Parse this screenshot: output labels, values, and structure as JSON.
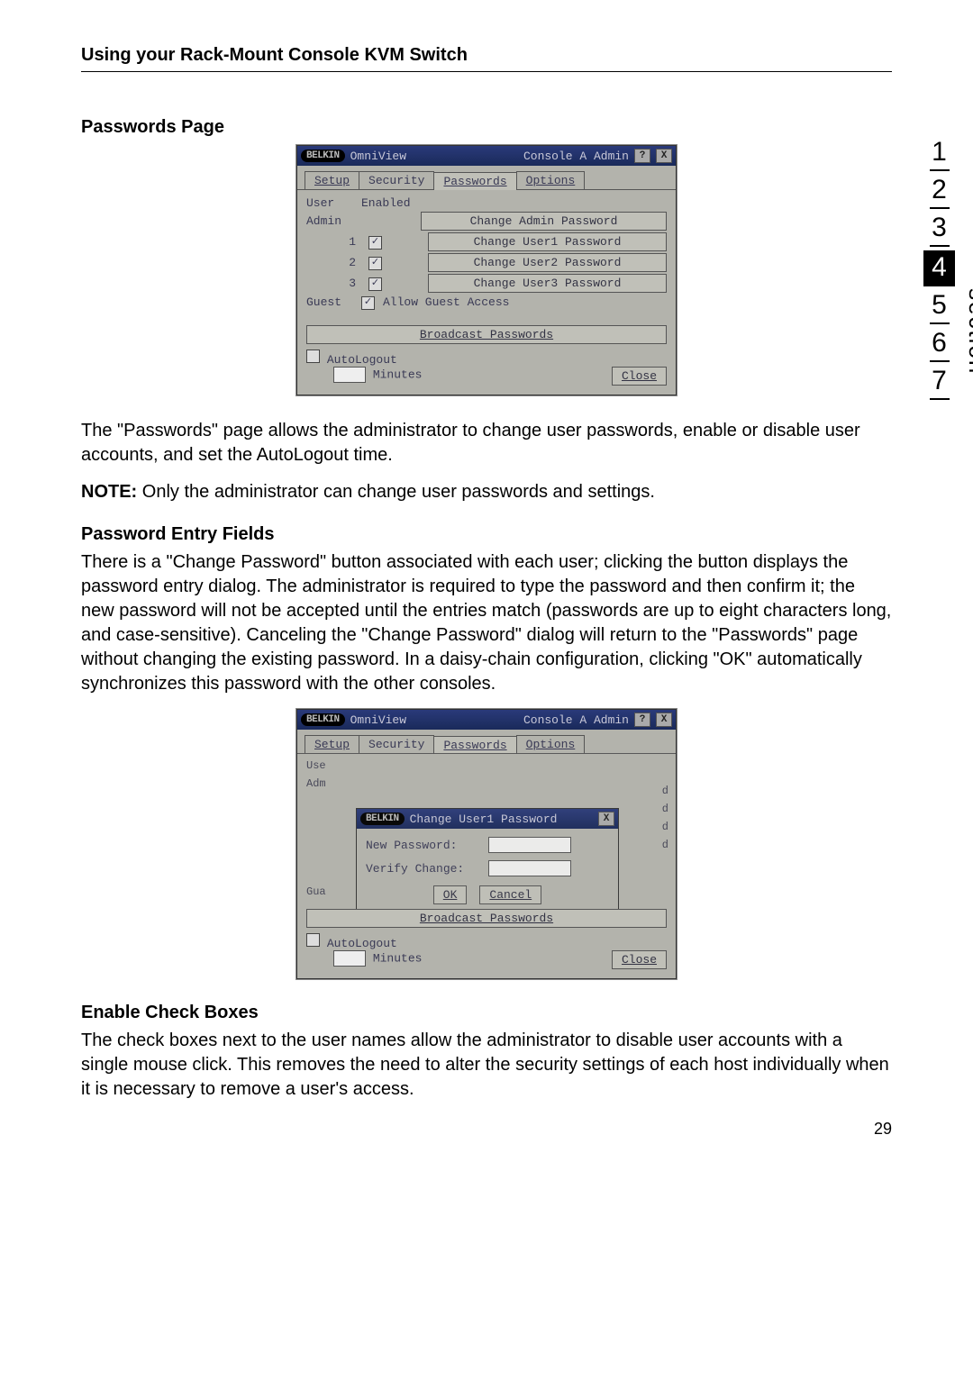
{
  "header": {
    "title": "Using your Rack-Mount Console KVM Switch"
  },
  "section_sidebar": {
    "label": "section",
    "numbers": [
      "1",
      "2",
      "3",
      "4",
      "5",
      "6",
      "7"
    ],
    "active": "4"
  },
  "headings": {
    "passwords_page": "Passwords Page",
    "password_entry_fields": "Password Entry Fields",
    "enable_check_boxes": "Enable Check Boxes"
  },
  "paragraphs": {
    "p1": "The \"Passwords\" page allows the administrator to change user passwords, enable or disable user accounts, and set the AutoLogout time.",
    "note_label": "NOTE:",
    "note_text": " Only the administrator can change user passwords and settings.",
    "p2": "There is a \"Change Password\" button associated with each user; clicking the button displays the password entry dialog. The administrator is required to type the password and then confirm it; the new password will not be accepted until the entries match (passwords are up to eight characters long, and case-sensitive). Canceling the \"Change Password\" dialog will return to the \"Passwords\" page without changing the existing password. In a daisy-chain configuration, clicking \"OK\" automatically synchronizes this password with the other consoles.",
    "p3": "The check boxes next to the user names allow the administrator to disable user accounts with a single mouse click. This removes the need to alter the security settings of each host individually when it is necessary to remove a user's access."
  },
  "page_number": "29",
  "osd1": {
    "brand": "BELKIN",
    "product": "OmniView",
    "title_right": "Console A Admin",
    "help": "?",
    "close": "X",
    "tabs": {
      "setup": "Setup",
      "security": "Security",
      "passwords": "Passwords",
      "options": "Options"
    },
    "col_user": "User",
    "col_enabled": "Enabled",
    "rows": {
      "admin": {
        "label": "Admin",
        "btn": "Change Admin Password"
      },
      "u1": {
        "label": "1",
        "btn": "Change User1 Password"
      },
      "u2": {
        "label": "2",
        "btn": "Change User2 Password"
      },
      "u3": {
        "label": "3",
        "btn": "Change User3 Password"
      },
      "guest": {
        "label": "Guest",
        "btn": "Allow Guest Access"
      }
    },
    "broadcast": "Broadcast Passwords",
    "autologout": "AutoLogout",
    "minutes": "Minutes",
    "close_btn": "Close"
  },
  "osd2": {
    "brand": "BELKIN",
    "product": "OmniView",
    "title_right": "Console A Admin",
    "help": "?",
    "close": "X",
    "tabs": {
      "setup": "Setup",
      "security": "Security",
      "passwords": "Passwords",
      "options": "Options"
    },
    "bg_labels": {
      "use": "Use",
      "adm": "Adm",
      "gua": "Gua",
      "d": "d"
    },
    "modal": {
      "brand": "BELKIN",
      "title": "Change User1 Password",
      "close": "X",
      "new_password": "New Password:",
      "verify_change": "Verify Change:",
      "ok": "OK",
      "cancel": "Cancel"
    },
    "broadcast": "Broadcast Passwords",
    "autologout": "AutoLogout",
    "minutes": "Minutes",
    "close_btn": "Close"
  }
}
